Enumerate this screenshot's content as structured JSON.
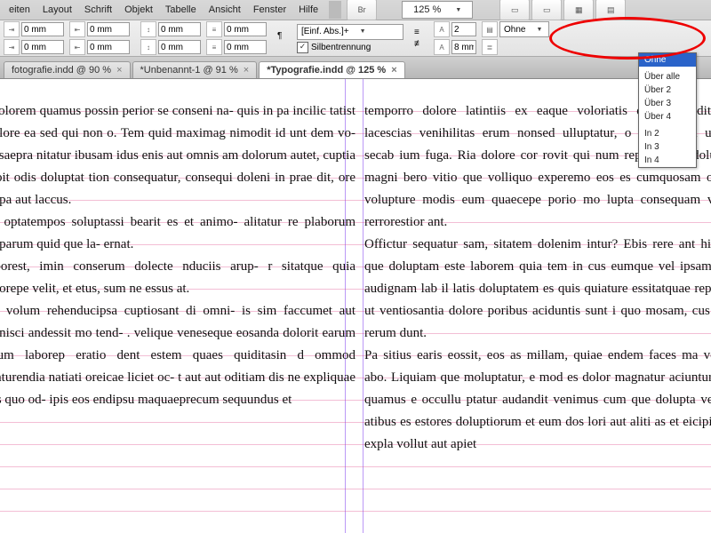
{
  "menu": {
    "items": [
      "eiten",
      "Layout",
      "Schrift",
      "Objekt",
      "Tabelle",
      "Ansicht",
      "Fenster",
      "Hilfe"
    ],
    "br_label": "Br",
    "zoom": "125 %"
  },
  "panel": {
    "mm": "0 mm",
    "mm8": "8 mm",
    "par_style": "[Einf. Abs.]+",
    "hyphen": "Silbentrennung",
    "lines": "2",
    "start": "Ohne",
    "startopts": [
      "Ohne",
      "Über alle",
      "Über 2",
      "Über 3",
      "Über 4",
      "In 2",
      "In 3",
      "In 4"
    ]
  },
  "tabs": [
    {
      "label": "fotografie.indd @ 90 %",
      "active": false
    },
    {
      "label": "*Unbenannt-1 @ 91 %",
      "active": false
    },
    {
      "label": "*Typografie.indd @ 125 %",
      "active": true
    }
  ],
  "text": {
    "col1": "e volorem quamus possin perior se conseni na- quis in pa incilic tatist molore ea sed qui non o. Tem quid maximag nimodit id unt dem vo- b usaepra nitatur ibusam idus enis aut omnis am dolorum autet, cuptia nobit odis doluptat tion consequatur, consequi doleni in prae dit, ore nulpa aut laccus.\niae optatempos soluptassi bearit es et animo- alitatur re plaborum nulparum quid que la- ernat.\ncaborest, imin conserum dolecte nduciis arup- r sitatque quia dolorepe velit, et etus, sum ne essus at.\nunt volum rehenducipsa cuptiosant di omni- is sim faccumet aut omnisci andessit mo tend- . velique veneseque eosanda dolorit earum rerum laborep eratio dent estem quaes quiditasin d ommod quaturendia natiati oreicae liciet oc- t aut aut oditiam dis ne expliquae ipis quo od- ipis eos endipsu maquaeprecum sequundus et",
    "col2": "temporro dolore latintiis ex eaque voloriatis doluptur aditionet lacescias venihilitas erum nonsed ulluptatur, o lantisquam undae|secab ium fuga. Ria dolore cor rovit qui num reped quias doluptas magni bero vitio que volliquo experemo eos es cumquosam omnit volupture modis eum quaecepe porio mo lupta consequam vitem rerrorestior ant.\nOffictur sequatur sam, sitatem dolenim intur? Ebis rere ant hicium que doluptam este laborem quia tem in cus eumque vel ipsam ium audignam lab il latis doluptatem es quis quiature essitatquae repta ad ut ventiosantia dolore poribus aciduntis sunt i quo mosam, cus eum rerum dunt.\nPa sitius earis eossit, eos as millam, quiae endem faces ma verum abo. Liquiam que moluptatur, e mod es dolor magnatur aciuntur rem quamus e occullu ptatur audandit venimus cum que dolupta vellupt atibus es estores doluptiorum et eum dos lori aut aliti as et eicipis aut expla vollut aut apiet"
  }
}
